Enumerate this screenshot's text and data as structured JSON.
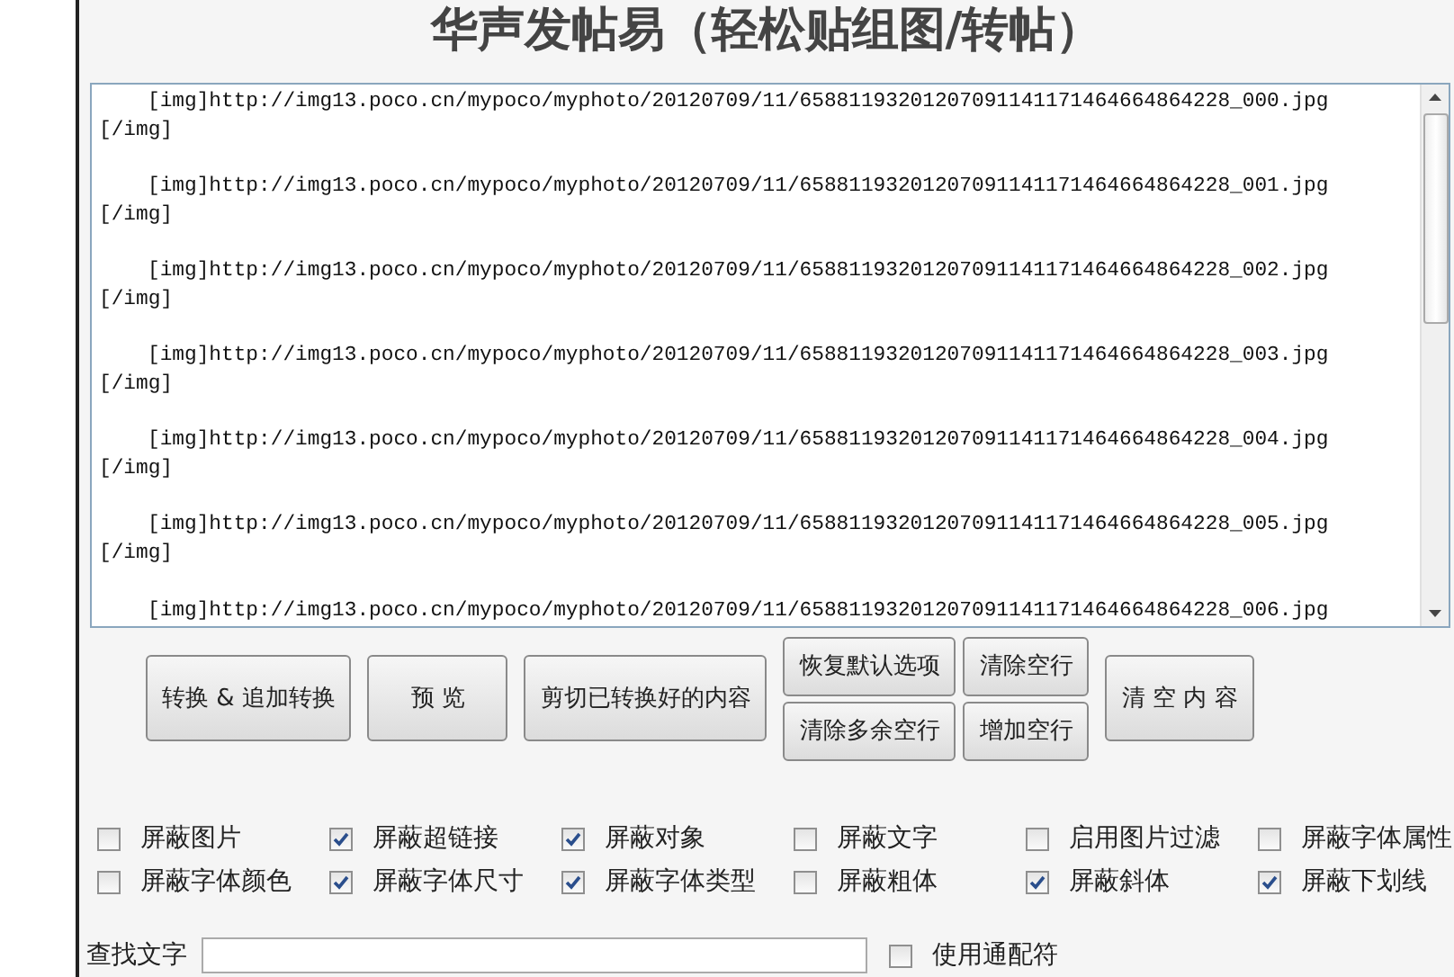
{
  "title": "华声发帖易（轻松贴组图/转帖）",
  "editor": {
    "entries": [
      {
        "url_line": "[img]http://img13.poco.cn/mypoco/myphoto/20120709/11/65881193201207091141171464664864228_000.jpg",
        "close_tag": "[/img]"
      },
      {
        "url_line": "[img]http://img13.poco.cn/mypoco/myphoto/20120709/11/65881193201207091141171464664864228_001.jpg",
        "close_tag": "[/img]"
      },
      {
        "url_line": "[img]http://img13.poco.cn/mypoco/myphoto/20120709/11/65881193201207091141171464664864228_002.jpg",
        "close_tag": "[/img]"
      },
      {
        "url_line": "[img]http://img13.poco.cn/mypoco/myphoto/20120709/11/65881193201207091141171464664864228_003.jpg",
        "close_tag": "[/img]"
      },
      {
        "url_line": "[img]http://img13.poco.cn/mypoco/myphoto/20120709/11/65881193201207091141171464664864228_004.jpg",
        "close_tag": "[/img]"
      },
      {
        "url_line": "[img]http://img13.poco.cn/mypoco/myphoto/20120709/11/65881193201207091141171464664864228_005.jpg",
        "close_tag": "[/img]"
      },
      {
        "url_line": "[img]http://img13.poco.cn/mypoco/myphoto/20120709/11/65881193201207091141171464664864228_006.jpg"
      }
    ]
  },
  "buttons": [
    {
      "label": "转换 & 追加转换",
      "kind": "tall"
    },
    {
      "label": "预 览",
      "kind": "tall"
    },
    {
      "label": "剪切已转换好的内容",
      "kind": "tall"
    },
    {
      "label": "恢复默认选项",
      "kind": "stacked"
    },
    {
      "label": "清除空行",
      "kind": "stacked"
    },
    {
      "label": "清除多余空行",
      "kind": "stacked"
    },
    {
      "label": "增加空行",
      "kind": "stacked"
    },
    {
      "label": "清 空 内 容",
      "kind": "tall"
    }
  ],
  "options": [
    {
      "label": "屏蔽图片",
      "checked": false
    },
    {
      "label": "屏蔽超链接",
      "checked": true
    },
    {
      "label": "屏蔽对象",
      "checked": true
    },
    {
      "label": "屏蔽文字",
      "checked": false
    },
    {
      "label": "启用图片过滤",
      "checked": false
    },
    {
      "label": "屏蔽字体属性",
      "checked": false
    },
    {
      "label": "屏蔽字体颜色",
      "checked": false
    },
    {
      "label": "屏蔽字体尺寸",
      "checked": true
    },
    {
      "label": "屏蔽字体类型",
      "checked": true
    },
    {
      "label": "屏蔽粗体",
      "checked": false
    },
    {
      "label": "屏蔽斜体",
      "checked": true
    },
    {
      "label": "屏蔽下划线",
      "checked": true
    }
  ],
  "search": {
    "label": "查找文字",
    "wildcard": {
      "label": "使用通配符",
      "checked": false
    }
  }
}
